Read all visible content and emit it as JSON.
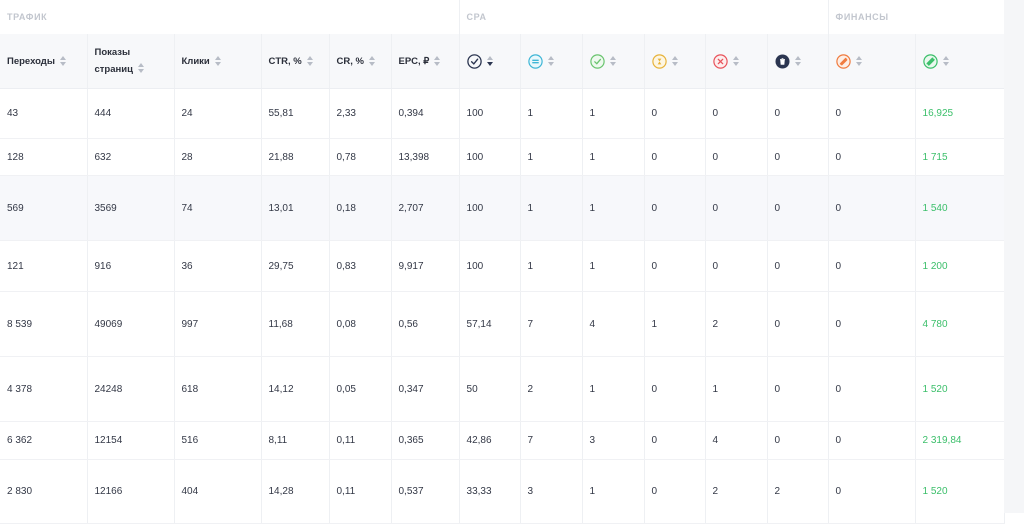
{
  "groups": {
    "traffic": "ТРАФИК",
    "cpa": "CPA",
    "finance": "ФИНАНСЫ"
  },
  "columns": {
    "visits": "Переходы",
    "page_views_1": "Показы",
    "page_views_2": "страниц",
    "clicks": "Клики",
    "ctr": "CTR, %",
    "cr": "CR, %",
    "epc": "EPC, ₽"
  },
  "icons": {
    "total": "check-dark-icon",
    "hold": "hold-equal-icon",
    "approved": "check-green-icon",
    "pending": "hourglass-icon",
    "rejected": "cross-red-icon",
    "trash": "trash-icon",
    "fin_1": "coin-orange-icon",
    "fin_2": "money-green-icon"
  },
  "colors": {
    "finance_value": "#3bbf6a",
    "rejected": "#e8535b",
    "approved": "#6ac46f",
    "hold": "#3fb6d6",
    "pending": "#e7b33b",
    "orange": "#f07b3f"
  },
  "rows": [
    [
      "43",
      "444",
      "24",
      "55,81",
      "2,33",
      "0,394",
      "100",
      "1",
      "1",
      "0",
      "0",
      "0",
      "0",
      "16,925"
    ],
    [
      "128",
      "632",
      "28",
      "21,88",
      "0,78",
      "13,398",
      "100",
      "1",
      "1",
      "0",
      "0",
      "0",
      "0",
      "1 715"
    ],
    [
      "569",
      "3569",
      "74",
      "13,01",
      "0,18",
      "2,707",
      "100",
      "1",
      "1",
      "0",
      "0",
      "0",
      "0",
      "1 540"
    ],
    [
      "121",
      "916",
      "36",
      "29,75",
      "0,83",
      "9,917",
      "100",
      "1",
      "1",
      "0",
      "0",
      "0",
      "0",
      "1 200"
    ],
    [
      "8 539",
      "49069",
      "997",
      "11,68",
      "0,08",
      "0,56",
      "57,14",
      "7",
      "4",
      "1",
      "2",
      "0",
      "0",
      "4 780"
    ],
    [
      "4 378",
      "24248",
      "618",
      "14,12",
      "0,05",
      "0,347",
      "50",
      "2",
      "1",
      "0",
      "1",
      "0",
      "0",
      "1 520"
    ],
    [
      "6 362",
      "12154",
      "516",
      "8,11",
      "0,11",
      "0,365",
      "42,86",
      "7",
      "3",
      "0",
      "4",
      "0",
      "0",
      "2 319,84"
    ],
    [
      "2 830",
      "12166",
      "404",
      "14,28",
      "0,11",
      "0,537",
      "33,33",
      "3",
      "1",
      "0",
      "2",
      "2",
      "0",
      "1 520"
    ]
  ]
}
